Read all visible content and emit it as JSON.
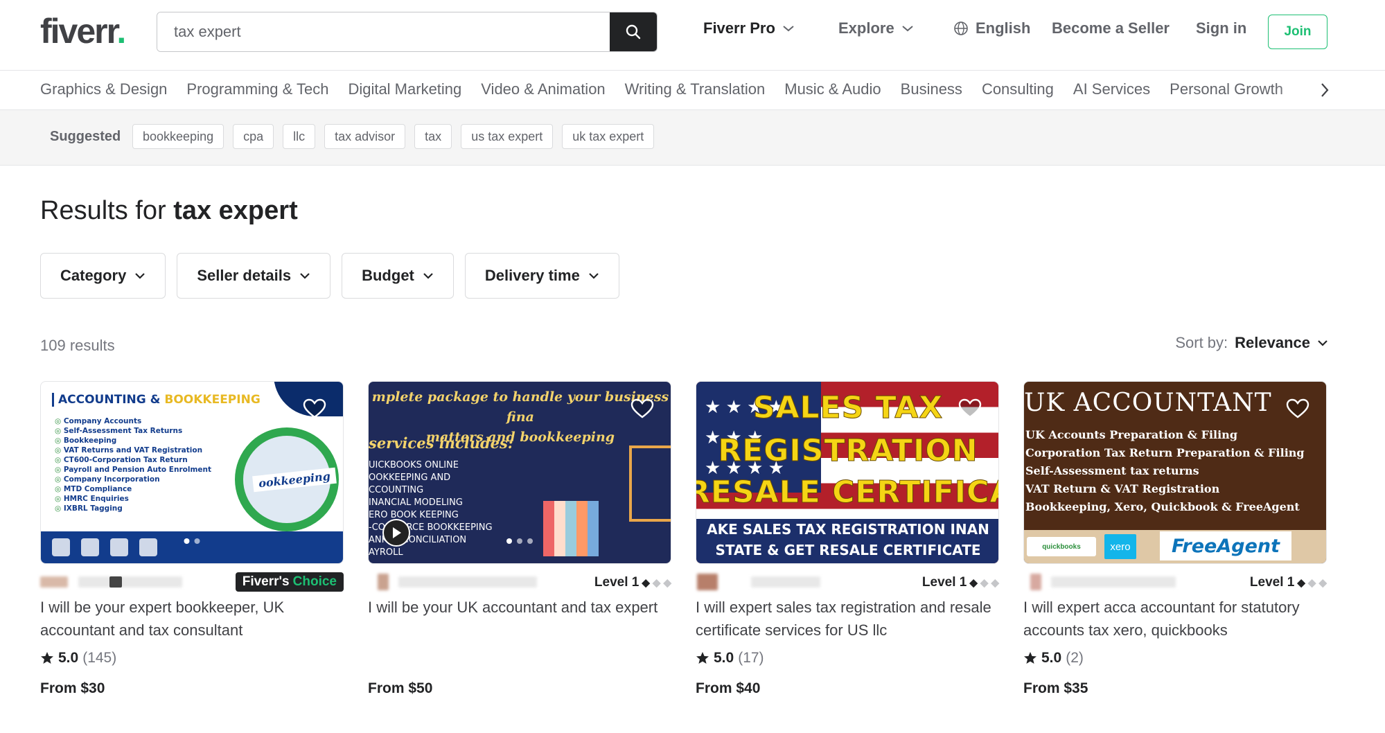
{
  "header": {
    "logo_text": "fiverr",
    "logo_dot": ".",
    "search_value": "tax expert",
    "nav": {
      "fiverr_pro": "Fiverr Pro",
      "explore": "Explore",
      "language": "English",
      "become_seller": "Become a Seller",
      "sign_in": "Sign in",
      "join": "Join"
    }
  },
  "categories": [
    "Graphics & Design",
    "Programming & Tech",
    "Digital Marketing",
    "Video & Animation",
    "Writing & Translation",
    "Music & Audio",
    "Business",
    "Consulting",
    "AI Services",
    "Personal Growth"
  ],
  "suggested": {
    "label": "Suggested",
    "items": [
      "bookkeeping",
      "cpa",
      "llc",
      "tax advisor",
      "tax",
      "us tax expert",
      "uk tax expert"
    ]
  },
  "results": {
    "prefix": "Results for",
    "query": "tax expert",
    "count": "109 results",
    "sort_label": "Sort by:",
    "sort_value": "Relevance"
  },
  "filters": [
    "Category",
    "Seller details",
    "Budget",
    "Delivery time"
  ],
  "gigs": [
    {
      "badge": "Fiverr's",
      "badge_highlight": "Choice",
      "title": "I will be your expert bookkeeper, UK accountant and tax consultant",
      "rating": "5.0",
      "reviews": "(145)",
      "price": "From $30",
      "thumb": {
        "heading_a": "ACCOUNTING &",
        "heading_b": "BOOKKEEPING",
        "list": [
          "Company Accounts",
          "Self-Assessment Tax Returns",
          "Bookkeeping",
          "VAT Returns and VAT Registration",
          "CT600-Corporation Tax Return",
          "Payroll and Pension Auto Enrolment",
          "Company Incorporation",
          "MTD Compliance",
          "HMRC Enquiries",
          "IXBRL Tagging"
        ],
        "book_word": "ookkeeping"
      }
    },
    {
      "level": "Level 1",
      "title": "I will be your UK accountant and tax expert",
      "price": "From $50",
      "thumb": {
        "line1": "mplete package to handle your business fina",
        "line2": "matters and bookkeeping",
        "subhead": "services includes:",
        "list": [
          "UICKBOOKS ONLINE",
          "OOKKEEPING AND",
          "CCOUNTING",
          "INANCIAL MODELING",
          "ERO BOOK KEEPING",
          "-COMMERCE BOOKKEEPING",
          "ANK RECONCILIATION",
          "AYROLL"
        ]
      }
    },
    {
      "level": "Level 1",
      "title": "I will expert sales tax registration and resale certificate services for US llc",
      "rating": "5.0",
      "reviews": "(17)",
      "price": "From $40",
      "thumb": {
        "line1": "SALES TAX",
        "line2": "REGISTRATION",
        "line3": "RESALE CERTIFICAT",
        "strip1": "AKE SALES TAX REGISTRATION INAN",
        "strip2": "STATE & GET RESALE CERTIFICATE"
      }
    },
    {
      "level": "Level 1",
      "title": "I will expert acca accountant for statutory accounts tax xero, quickbooks",
      "rating": "5.0",
      "reviews": "(2)",
      "price": "From $35",
      "thumb": {
        "heading": "UK ACCOUNTANT",
        "list": [
          "UK Accounts Preparation & Filing",
          "Corporation Tax Return Preparation & Filing",
          "Self-Assessment tax returns",
          "VAT Return & VAT Registration",
          "Bookkeeping, Xero, Quickbook & FreeAgent"
        ],
        "logo1": "quickbooks",
        "logo2": "xero",
        "logo3": "FreeAgent"
      }
    }
  ],
  "icons": {
    "search": "search-icon",
    "chevron": "chevron-down-icon",
    "globe": "globe-icon",
    "heart": "heart-icon",
    "star": "star-icon",
    "diamond": "level-diamond-icon",
    "play": "play-icon",
    "next": "chevron-right-icon"
  },
  "colors": {
    "brand_green": "#1dbf73",
    "text_dark": "#222325",
    "text_muted": "#74767e"
  }
}
